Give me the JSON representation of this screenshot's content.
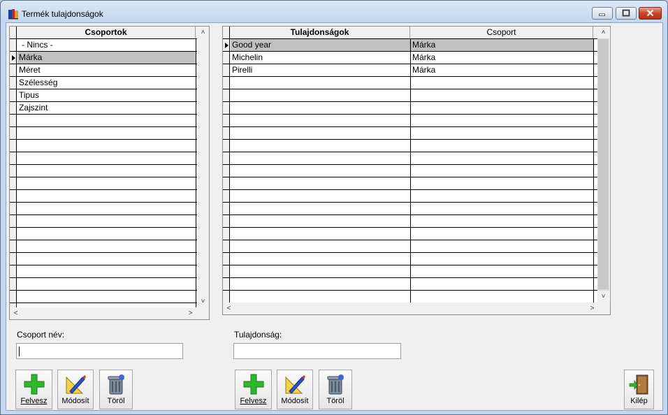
{
  "window": {
    "title": "Termék tulajdonságok"
  },
  "groups_grid": {
    "header": "Csoportok",
    "rows": [
      "- Nincs -",
      "Márka",
      "Méret",
      "Szélesség",
      "Tipus",
      "Zajszint"
    ],
    "selected_index": 1
  },
  "props_grid": {
    "headers": [
      "Tulajdonságok",
      "Csoport"
    ],
    "rows": [
      [
        "Good year",
        "Márka"
      ],
      [
        "Michelin",
        "Márka"
      ],
      [
        "Pirelli",
        "Márka"
      ]
    ],
    "selected_index": 0
  },
  "group_form": {
    "label": "Csoport név:",
    "value": ""
  },
  "prop_form": {
    "label": "Tulajdonság:",
    "value": ""
  },
  "group_buttons": {
    "add": "Felvesz",
    "edit": "Módosít",
    "delete": "Töröl"
  },
  "prop_buttons": {
    "add": "Felvesz",
    "edit": "Módosít",
    "delete": "Töröl"
  },
  "exit_button": "Kilép",
  "icons": {
    "add": "plus-icon",
    "edit": "ruler-pencil-icon",
    "delete": "trash-can-icon",
    "exit": "door-exit-icon"
  },
  "colors": {
    "selected_row": "#c0c0c0",
    "add_green": "#2fb82f",
    "close_red": "#c9452c"
  }
}
